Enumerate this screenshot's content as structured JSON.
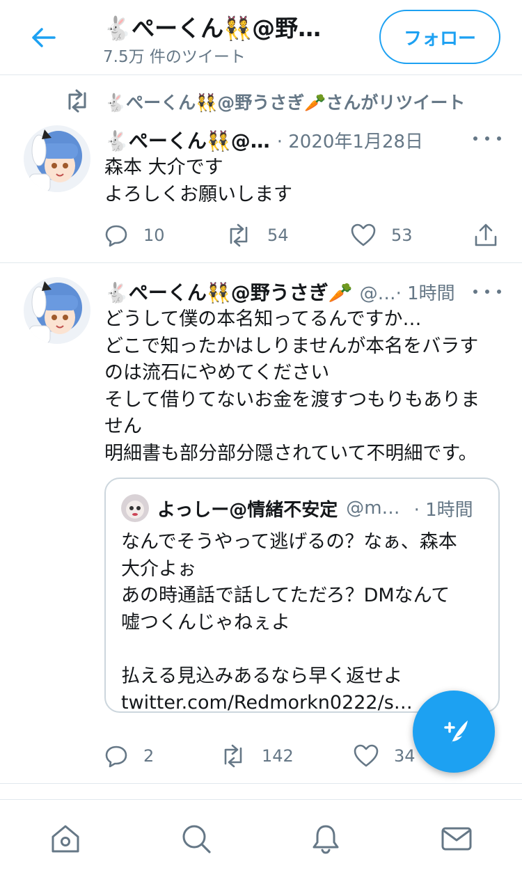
{
  "header": {
    "back_icon": "arrow-left-icon",
    "name": "🐇ぺーくん👯@野…",
    "tweet_count": "7.5万 件のツイート",
    "follow_label": "フォロー",
    "accent": "#1da1f2"
  },
  "tweets": [
    {
      "retweet_label": "🐇ぺーくん👯@野うさぎ🥕さんがリツイート",
      "display_name": "🐇ぺーくん👯@…",
      "meta": "· 2020年1月28日",
      "lines": [
        "森本 大介です",
        "よろしくお願いします"
      ],
      "reply_count": "10",
      "retweet_count": "54",
      "like_count": "53"
    },
    {
      "display_name": "🐇ぺーくん👯@野うさぎ🥕",
      "meta": "@…· 1時間",
      "lines": [
        "どうして僕の本名知ってるんですか…",
        "どこで知ったかはしりませんが本名をバラす",
        "のは流石にやめてください",
        "そして借りてないお金を渡すつもりもありま",
        "せん",
        "明細書も部分部分隠されていて不明細です。"
      ],
      "quote": {
        "display_name": "よっしー@情緒不安定",
        "handle": "@m…",
        "meta": "· 1時間",
        "lines": [
          "なんでそうやって逃げるの？なぁ、森本",
          "大介よぉ",
          "あの時通話で話してただろ？DMなんて",
          "嘘つくんじゃねぇよ",
          "",
          "払える見込みあるなら早く返せよ",
          "twitter.com/Redmorkn0222/s…"
        ]
      },
      "reply_count": "2",
      "retweet_count": "142",
      "like_count": "34"
    }
  ],
  "fab": {
    "icon": "compose-tweet-icon"
  },
  "tabbar": {
    "items": [
      "home-icon",
      "search-icon",
      "notifications-icon",
      "messages-icon"
    ]
  }
}
